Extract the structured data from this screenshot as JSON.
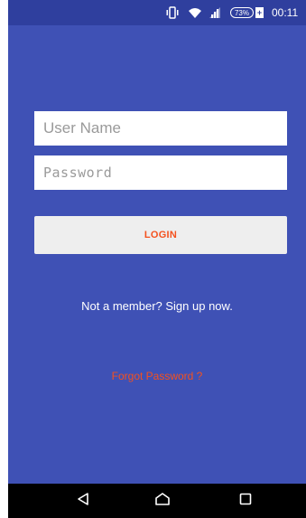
{
  "status_bar": {
    "battery": "73%",
    "time": "00:11",
    "icons": [
      "vibrate-icon",
      "wifi-icon",
      "signal-icon",
      "battery-icon"
    ]
  },
  "login_form": {
    "username_placeholder": "User Name",
    "password_placeholder": "Password",
    "login_label": "LOGIN",
    "signup_text": "Not a member? Sign up now.",
    "forgot_text": "Forgot Password ?"
  },
  "nav_bar": {
    "icons": [
      "back-icon",
      "home-icon",
      "recents-icon"
    ]
  },
  "colors": {
    "background": "#3F51B5",
    "status_bar": "#2F3F9E",
    "accent": "#F4511E",
    "button": "#EEEEEE",
    "nav_bar": "#000000"
  }
}
